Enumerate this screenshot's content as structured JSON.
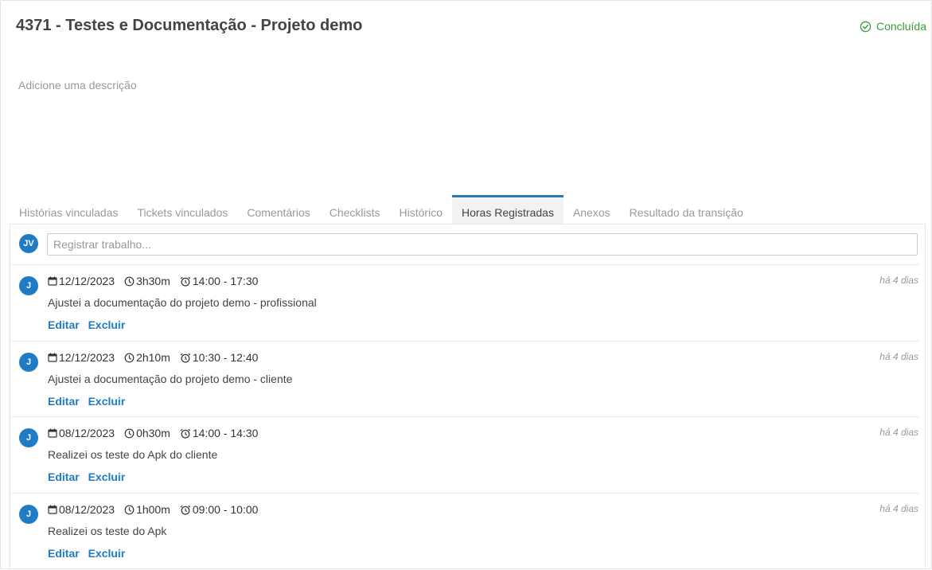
{
  "header": {
    "title": "4371 - Testes e Documentação - Projeto demo",
    "status": "Concluída",
    "description_placeholder": "Adicione uma descrição"
  },
  "colors": {
    "accent": "#1f7cc4",
    "success": "#3a9a3a",
    "muted": "#999999"
  },
  "tabs": [
    {
      "label": "Histórias vinculadas"
    },
    {
      "label": "Tickets vinculados"
    },
    {
      "label": "Comentários"
    },
    {
      "label": "Checklists"
    },
    {
      "label": "Histórico"
    },
    {
      "label": "Horas Registradas",
      "active": true
    },
    {
      "label": "Anexos"
    },
    {
      "label": "Resultado da transição"
    }
  ],
  "composer": {
    "avatar": "JV",
    "placeholder": "Registrar trabalho..."
  },
  "entries": [
    {
      "avatar": "J",
      "date": "12/12/2023",
      "duration": "3h30m",
      "range": "14:00 - 17:30",
      "ago": "há 4 dias",
      "text": "Ajustei a documentação do projeto demo - profissional",
      "edit": "Editar",
      "delete": "Excluir"
    },
    {
      "avatar": "J",
      "date": "12/12/2023",
      "duration": "2h10m",
      "range": "10:30 - 12:40",
      "ago": "há 4 dias",
      "text": "Ajustei a documentação do projeto demo - cliente",
      "edit": "Editar",
      "delete": "Excluir"
    },
    {
      "avatar": "J",
      "date": "08/12/2023",
      "duration": "0h30m",
      "range": "14:00 - 14:30",
      "ago": "há 4 dias",
      "text": "Realizei os teste do Apk do cliente",
      "edit": "Editar",
      "delete": "Excluir"
    },
    {
      "avatar": "J",
      "date": "08/12/2023",
      "duration": "1h00m",
      "range": "09:00 - 10:00",
      "ago": "há 4 dias",
      "text": "Realizei os teste do Apk",
      "edit": "Editar",
      "delete": "Excluir"
    }
  ],
  "icons": {
    "status": "check-circle-icon",
    "date": "calendar-icon",
    "duration": "clock-icon",
    "range": "alarm-icon"
  }
}
